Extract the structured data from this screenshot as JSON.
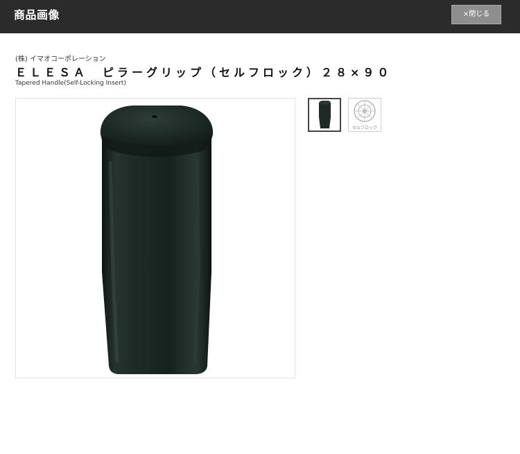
{
  "header": {
    "title": "商品画像",
    "close_label": "×閉じる"
  },
  "product": {
    "maker": "(株) イマオコーポレーション",
    "name": "ＥＬＥＳＡ　ピラーグリップ（セルフロック）２８×９０",
    "subtitle": "Tapered Handle(Self-Locking Insert)"
  },
  "thumbnails": [
    {
      "caption": "",
      "icon": "grip-thumbnail-icon"
    },
    {
      "caption": "セルフロック",
      "icon": "self-lock-insert-thumbnail-icon"
    }
  ],
  "colors": {
    "header_bg": "#2b2b2b",
    "close_button_bg": "#8e8e8e",
    "grip_color": "#1e2a26"
  }
}
